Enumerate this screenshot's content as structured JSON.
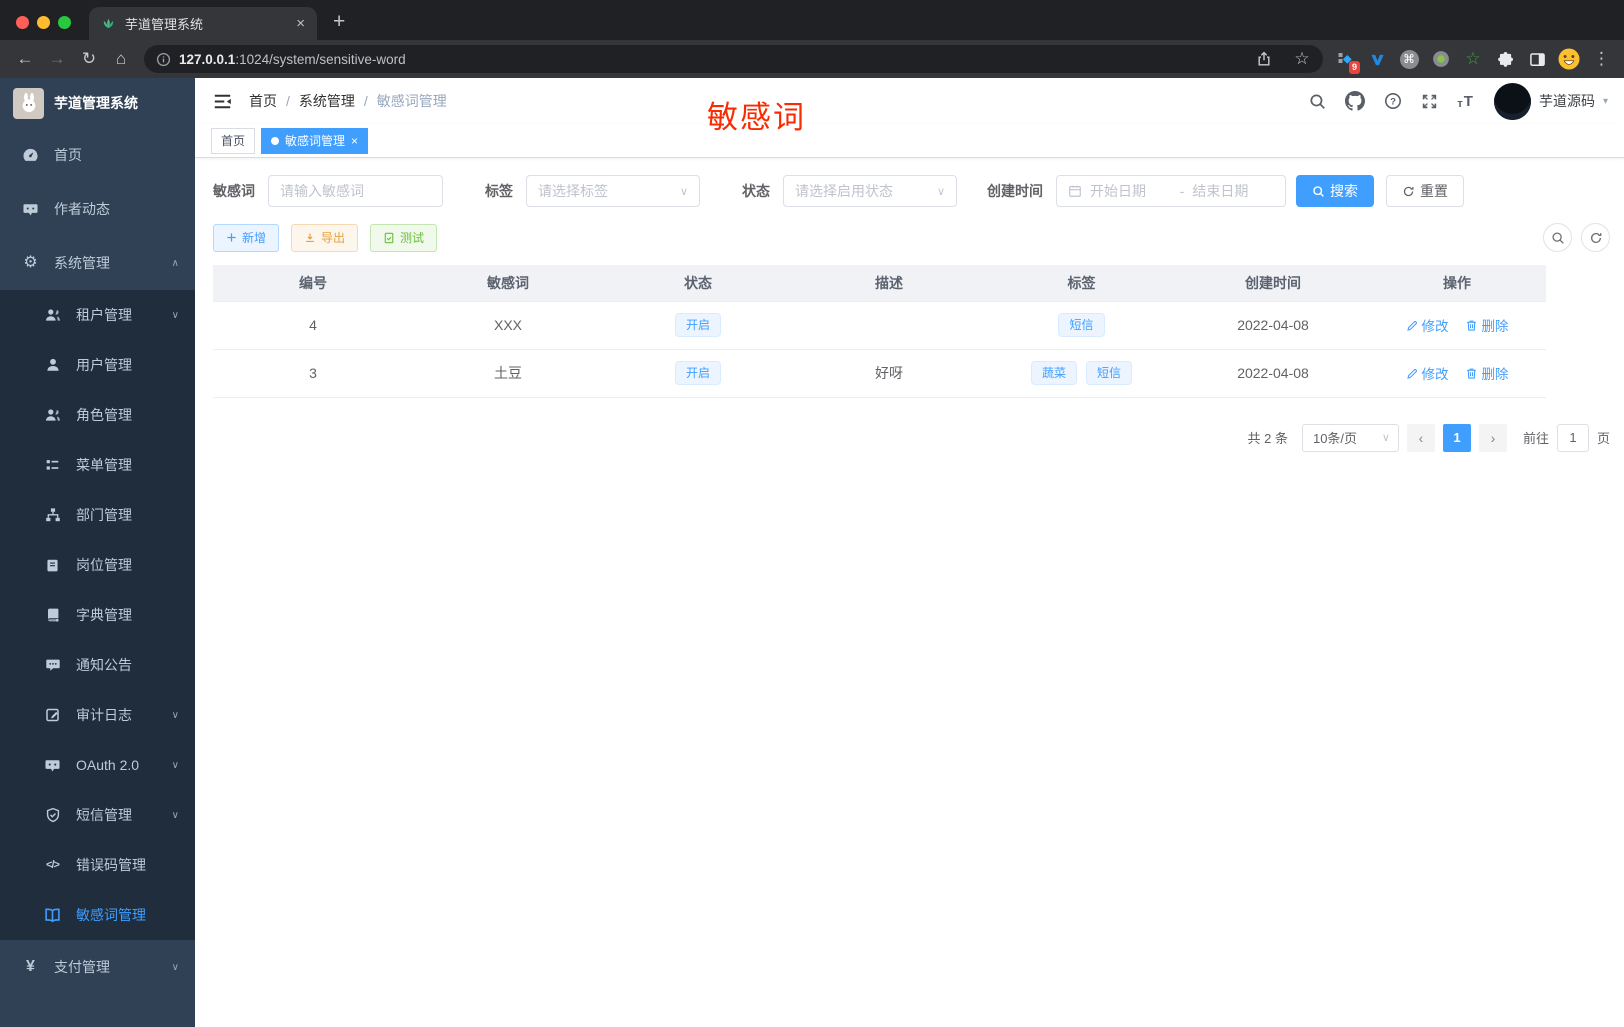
{
  "colors": {
    "primary": "#409eff",
    "success": "#67c23a",
    "warning": "#e6a23c",
    "annotation_red": "#f92b02",
    "sidebar_bg": "#304156",
    "submenu_bg": "#1f2d3d",
    "tag_bg": "#ecf5ff"
  },
  "browser": {
    "tab_title": "芋道管理系统",
    "url_host": "127.0.0.1",
    "url_path": ":1024/system/sensitive-word",
    "extension_badge": "9"
  },
  "icons": {
    "close": "×",
    "plus_tab": "+",
    "back": "←",
    "forward": "→",
    "reload": "↻",
    "home": "⌂",
    "star": "☆",
    "green_star": "☆",
    "command": "⌘",
    "dots": "⋮",
    "caret_down": "▾",
    "chevron_down": "∨",
    "chevron_up": "∧",
    "page_prev": "‹",
    "page_next": "›",
    "error_code": "</>",
    "yen": "¥",
    "gear": "⚙",
    "font_size_small": "т",
    "font_size_large": "T",
    "range_separator": "-"
  },
  "sidebar": {
    "logo_title": "芋道管理系统",
    "items_top": [
      "首页",
      "作者动态",
      "系统管理"
    ],
    "items_sub": [
      "租户管理",
      "用户管理",
      "角色管理",
      "菜单管理",
      "部门管理",
      "岗位管理",
      "字典管理",
      "通知公告",
      "审计日志",
      "OAuth 2.0",
      "短信管理",
      "错误码管理",
      "敏感词管理"
    ],
    "items_bottom": [
      "支付管理"
    ],
    "active_item": "敏感词管理"
  },
  "header": {
    "breadcrumb": [
      "首页",
      "系统管理",
      "敏感词管理"
    ],
    "breadcrumb_separator": "/",
    "user_name": "芋道源码",
    "annotation": "敏感词"
  },
  "tags_view": {
    "tabs": [
      {
        "label": "首页",
        "active": false
      },
      {
        "label": "敏感词管理",
        "active": true
      }
    ]
  },
  "filters": {
    "keyword_label": "敏感词",
    "keyword_placeholder": "请输入敏感词",
    "tag_label": "标签",
    "tag_placeholder": "请选择标签",
    "status_label": "状态",
    "status_placeholder": "请选择启用状态",
    "time_label": "创建时间",
    "time_start_placeholder": "开始日期",
    "time_separator": "-",
    "time_end_placeholder": "结束日期",
    "search_label": "搜索",
    "reset_label": "重置"
  },
  "toolbar": {
    "add_label": "新增",
    "export_label": "导出",
    "test_label": "测试"
  },
  "table": {
    "columns": [
      "编号",
      "敏感词",
      "状态",
      "描述",
      "标签",
      "创建时间",
      "操作"
    ],
    "rows": [
      {
        "id": "4",
        "word": "XXX",
        "status": "开启",
        "description": "",
        "tags": [
          "短信"
        ],
        "created": "2022-04-08",
        "edit": "修改",
        "delete": "删除"
      },
      {
        "id": "3",
        "word": "土豆",
        "status": "开启",
        "description": "好呀",
        "tags": [
          "蔬菜",
          "短信"
        ],
        "created": "2022-04-08",
        "edit": "修改",
        "delete": "删除"
      }
    ]
  },
  "pagination": {
    "total": "共 2 条",
    "page_size": "10条/页",
    "current_page": "1",
    "goto_label": "前往",
    "goto_value": "1",
    "unit_label": "页"
  }
}
